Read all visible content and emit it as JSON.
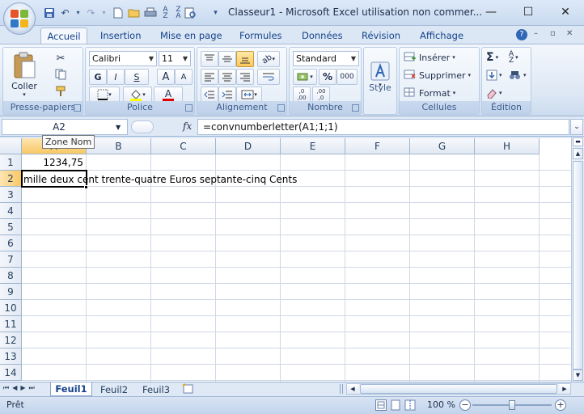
{
  "window": {
    "title": "Classeur1 - Microsoft Excel utilisation non commer...",
    "minimize_glyph": "—",
    "maximize_glyph": "☐",
    "close_glyph": "✕"
  },
  "quick_access": {
    "icons": [
      "save-icon",
      "undo-icon",
      "redo-icon",
      "new-icon",
      "open-icon",
      "print-icon",
      "sort-asc-icon",
      "sort-desc-icon",
      "print-preview-icon",
      "customize-icon"
    ]
  },
  "tabs": [
    {
      "label": "Accueil",
      "active": true
    },
    {
      "label": "Insertion"
    },
    {
      "label": "Mise en page"
    },
    {
      "label": "Formules"
    },
    {
      "label": "Données"
    },
    {
      "label": "Révision"
    },
    {
      "label": "Affichage"
    }
  ],
  "ribbon": {
    "clipboard": {
      "label": "Presse-papiers",
      "paste": "Coller"
    },
    "font": {
      "label": "Police",
      "name": "Calibri",
      "size": "11",
      "bold": "G",
      "italic": "I",
      "underline": "S",
      "grow": "A",
      "shrink": "A",
      "color": "A"
    },
    "alignment": {
      "label": "Alignement"
    },
    "number": {
      "label": "Nombre",
      "format": "Standard",
      "percent": "%",
      "thousands": "000",
      "inc_dec": ",0 ,00",
      "dec_dec": ",00 ,0"
    },
    "style": {
      "label": "Style"
    },
    "cells": {
      "label": "Cellules",
      "insert": "Insérer",
      "delete": "Supprimer",
      "format": "Format"
    },
    "editing": {
      "label": "Édition",
      "sum": "Σ"
    }
  },
  "formula_bar": {
    "name_box": "A2",
    "fx": "fx",
    "formula": "=convnumberletter(A1;1;1)",
    "tooltip": "Zone Nom"
  },
  "grid": {
    "columns": [
      "A",
      "B",
      "C",
      "D",
      "E",
      "F",
      "G",
      "H"
    ],
    "rows": [
      "1",
      "2",
      "3",
      "4",
      "5",
      "6",
      "7",
      "8",
      "9",
      "10",
      "11",
      "12",
      "13",
      "14"
    ],
    "a1_value": "1234,75",
    "a2_value": "mille deux cent trente-quatre Euros septante-cinq Cents",
    "active_cell": "A2"
  },
  "sheets": [
    {
      "label": "Feuil1",
      "active": true
    },
    {
      "label": "Feuil2"
    },
    {
      "label": "Feuil3"
    }
  ],
  "status": {
    "ready": "Prêt",
    "zoom": "100 %",
    "zoom_level": 0.5
  }
}
